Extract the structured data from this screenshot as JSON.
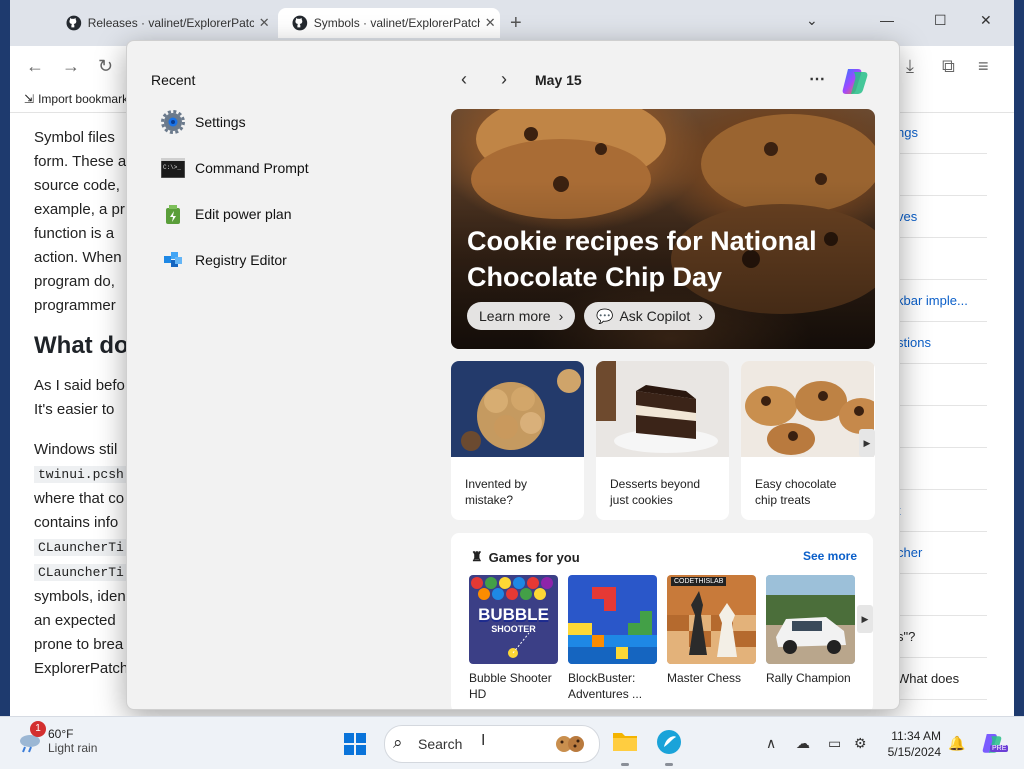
{
  "browser": {
    "tabs": [
      {
        "title": "Releases · valinet/ExplorerPatcher",
        "active": false
      },
      {
        "title": "Symbols · valinet/ExplorerPatcher",
        "active": true
      }
    ],
    "bookmark": "Import bookmarks"
  },
  "article": {
    "p1": [
      "Symbol files",
      "form. These a",
      "source code,",
      "example, a pr",
      "function is a",
      "action. When",
      "program do,",
      "programmer"
    ],
    "heading": "What do",
    "p2": [
      "As I said befo",
      "It's easier to"
    ],
    "p3a": [
      "Windows stil"
    ],
    "code1": "twinui.pcsh",
    "p3b": [
      "where that co",
      "contains info"
    ],
    "code2": "CLauncherTi",
    "code3": "CLauncherTi",
    "p3c": [
      "symbols, iden",
      "an expected",
      "prone to brea",
      "ExplorerPatch"
    ]
  },
  "toc": [
    "ngs",
    "",
    "ves",
    "",
    "kbar imple...",
    "stions",
    "",
    "",
    "",
    "t",
    "cher",
    "",
    "s\"?",
    "What does"
  ],
  "flyout": {
    "recent_title": "Recent",
    "recent": [
      "Settings",
      "Command Prompt",
      "Edit power plan",
      "Registry Editor"
    ],
    "date": "May 15",
    "hero": {
      "title": "Cookie recipes for National Chocolate Chip Day",
      "learn_more": "Learn more",
      "ask_copilot": "Ask Copilot"
    },
    "cards": [
      {
        "caption": "Invented by mistake?"
      },
      {
        "caption": "Desserts beyond just cookies"
      },
      {
        "caption": "Easy chocolate chip treats"
      }
    ],
    "games": {
      "title": "Games for you",
      "see_more": "See more",
      "items": [
        "Bubble Shooter HD",
        "BlockBuster: Adventures ...",
        "Master Chess",
        "Rally Champion"
      ],
      "bubble_logo_1": "BUBBLE",
      "bubble_logo_2": "SHOOTER",
      "chess_badge": "CODETHISLAB"
    }
  },
  "taskbar": {
    "temp": "60°F",
    "condition": "Light rain",
    "alert_count": "1",
    "search_placeholder": "Search",
    "time": "11:34 AM",
    "date": "5/15/2024",
    "copilot_badge": "PRE"
  }
}
